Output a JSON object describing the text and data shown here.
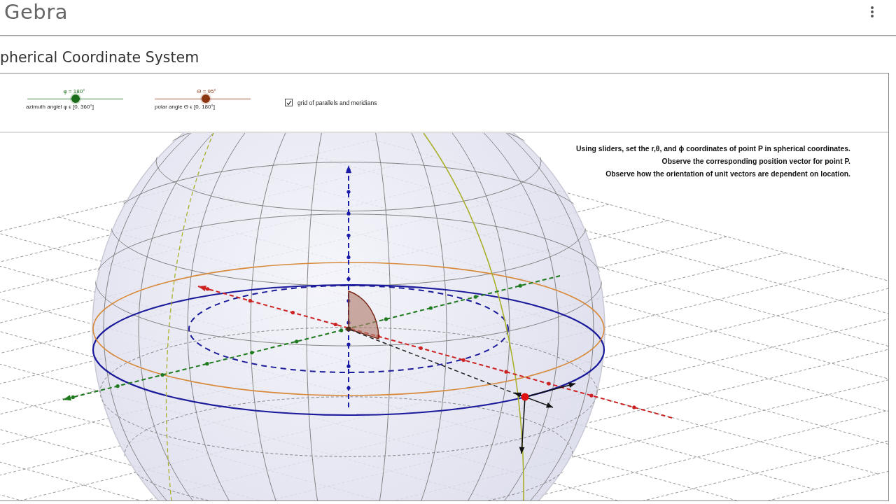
{
  "header": {
    "app_name": "Gebra"
  },
  "title": "pherical Coordinate System",
  "sliders": [
    {
      "value_label": "φ = 180°",
      "caption": "azimuth anglel φ ϵ [0, 360°]",
      "level": 0.5,
      "color": "#1a6b1a"
    },
    {
      "value_label": "Θ = 95°",
      "caption": "polar angle Θ ϵ [0, 180°]",
      "level": 0.53,
      "color": "#8a3510"
    }
  ],
  "checkbox": {
    "label": "grid of parallels and meridians",
    "checked": true
  },
  "instructions": [
    "Using sliders, set the r,θ, and ϕ coordinates of point P in spherical coordinates.",
    "Observe the corresponding position vector for point P.",
    "Observe how the orientation of unit vectors are dependent on location."
  ]
}
